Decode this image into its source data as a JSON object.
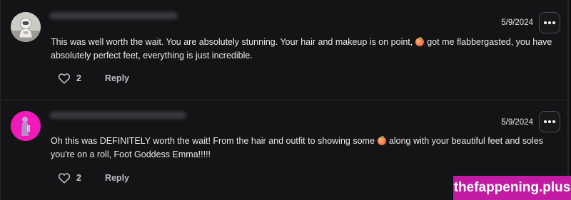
{
  "comments": [
    {
      "date": "5/9/2024",
      "text_before_emoji": "This was well worth the wait. You are absolutely stunning. Your hair and makeup is on point,",
      "text_after_emoji": "got me flabbergasted, you have absolutely perfect feet, everything is just incredible.",
      "like_count": "2",
      "reply_label": "Reply"
    },
    {
      "date": "5/9/2024",
      "text_before_emoji": "Oh this was DEFINITELY worth the wait! From the hair and outfit to showing some",
      "text_after_emoji": "along with your beautiful feet and soles you're on a roll, Foot Goddess Emma!!!!!",
      "like_count": "2",
      "reply_label": "Reply"
    }
  ],
  "watermark": "thefappening.plus",
  "icons": {
    "like": "heart-icon",
    "more": "more-options-icon",
    "emoji": "peach-emoji-icon"
  },
  "colors": {
    "background": "#141416",
    "text": "#ececee",
    "watermark_bg": "#c21aa3",
    "avatar_2": "#f01ab8"
  }
}
